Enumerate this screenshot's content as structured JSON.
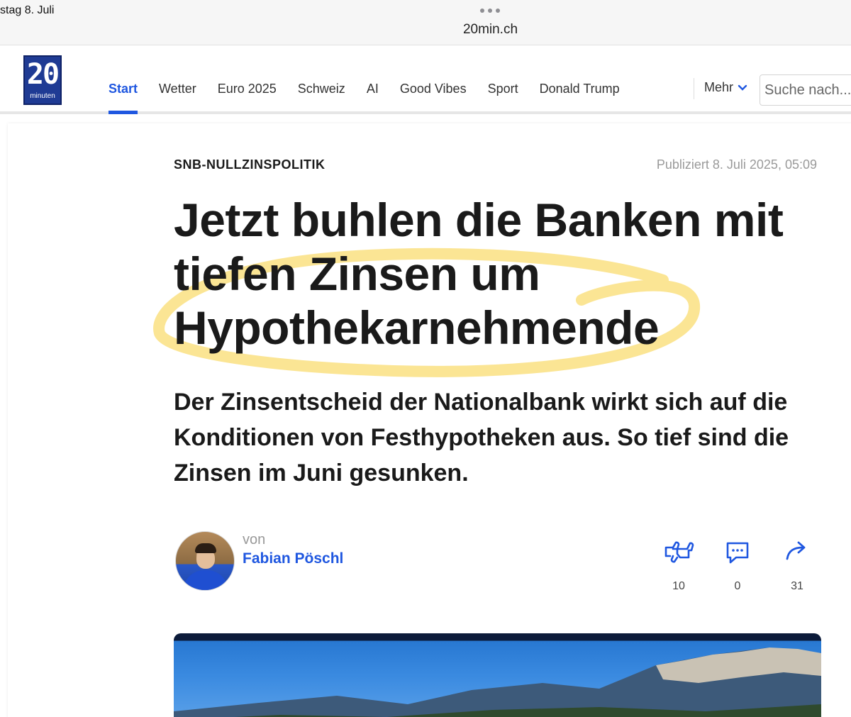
{
  "status": {
    "date": "stag 8. Juli"
  },
  "browser": {
    "url": "20min.ch"
  },
  "site": {
    "logo": {
      "number": "20",
      "name": "minuten"
    },
    "nav": [
      "Start",
      "Wetter",
      "Euro 2025",
      "Schweiz",
      "AI",
      "Good Vibes",
      "Sport",
      "Donald Trump"
    ],
    "more_label": "Mehr",
    "search_placeholder": "Suche nach..."
  },
  "article": {
    "kicker": "SNB-NULLZINSPOLITIK",
    "published": "Publiziert 8. Juli 2025, 05:09",
    "headline": "Jetzt buhlen die Banken mit tiefen Zinsen um Hypothekarnehmende",
    "lead": "Der Zinsentscheid der Nationalbank wirkt sich auf die Konditionen von Festhypotheken aus. So tief sind die Zinsen im Juni gesunken.",
    "byline_prefix": "von",
    "author": "Fabian Pöschl",
    "actions": {
      "reactions": "10",
      "comments": "0",
      "shares": "31"
    }
  },
  "colors": {
    "accent": "#1f57e0",
    "logo_blue": "#1f3b94",
    "highlight": "#f7cf3c"
  }
}
